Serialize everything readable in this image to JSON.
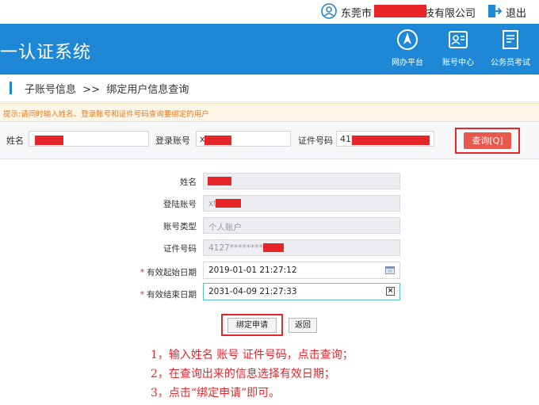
{
  "topbar": {
    "company_prefix": "东莞市",
    "company_suffix": "技有限公司",
    "logout_label": "退出"
  },
  "header": {
    "system_title": "一认证系统",
    "nav": [
      {
        "label": "网办平台",
        "icon": "compass-icon"
      },
      {
        "label": "账号中心",
        "icon": "id-card-icon"
      },
      {
        "label": "公务员考试",
        "icon": "exam-paper-icon"
      }
    ]
  },
  "breadcrumb": {
    "parent": "子账号信息",
    "separator": ">>",
    "current": "绑定用户信息查询"
  },
  "tip": "提示:请同时输入姓名、登录账号和证件号码查询要绑定的用户",
  "search": {
    "name_label": "姓名",
    "name_value": "",
    "account_label": "登录账号",
    "account_value": "x",
    "id_label": "证件号码",
    "id_value": "41",
    "query_label": "查询[Q]"
  },
  "form": {
    "name_label": "姓名",
    "name_value": "",
    "account_label": "登陆账号",
    "account_value": "xt",
    "type_label": "账号类型",
    "type_value": "个人账户",
    "id_label": "证件号码",
    "id_value": "4127*********",
    "start_label": "有效起始日期",
    "start_value": "2019-01-01 21:27:12",
    "end_label": "有效结束日期",
    "end_value": "2031-04-09 21:27:33",
    "required_mark": "*",
    "bind_label": "绑定申请",
    "back_label": "返回"
  },
  "notes": [
    "1，输入姓名 账号 证件号码，点击查询；",
    "2，在查询出来的信息选择有效日期；",
    "3，点击“绑定申请”即可。"
  ],
  "colors": {
    "header_blue": "#1e88d6",
    "annotation_red": "#e8262a",
    "query_button": "#e8594d",
    "tip_text": "#e57a23"
  }
}
